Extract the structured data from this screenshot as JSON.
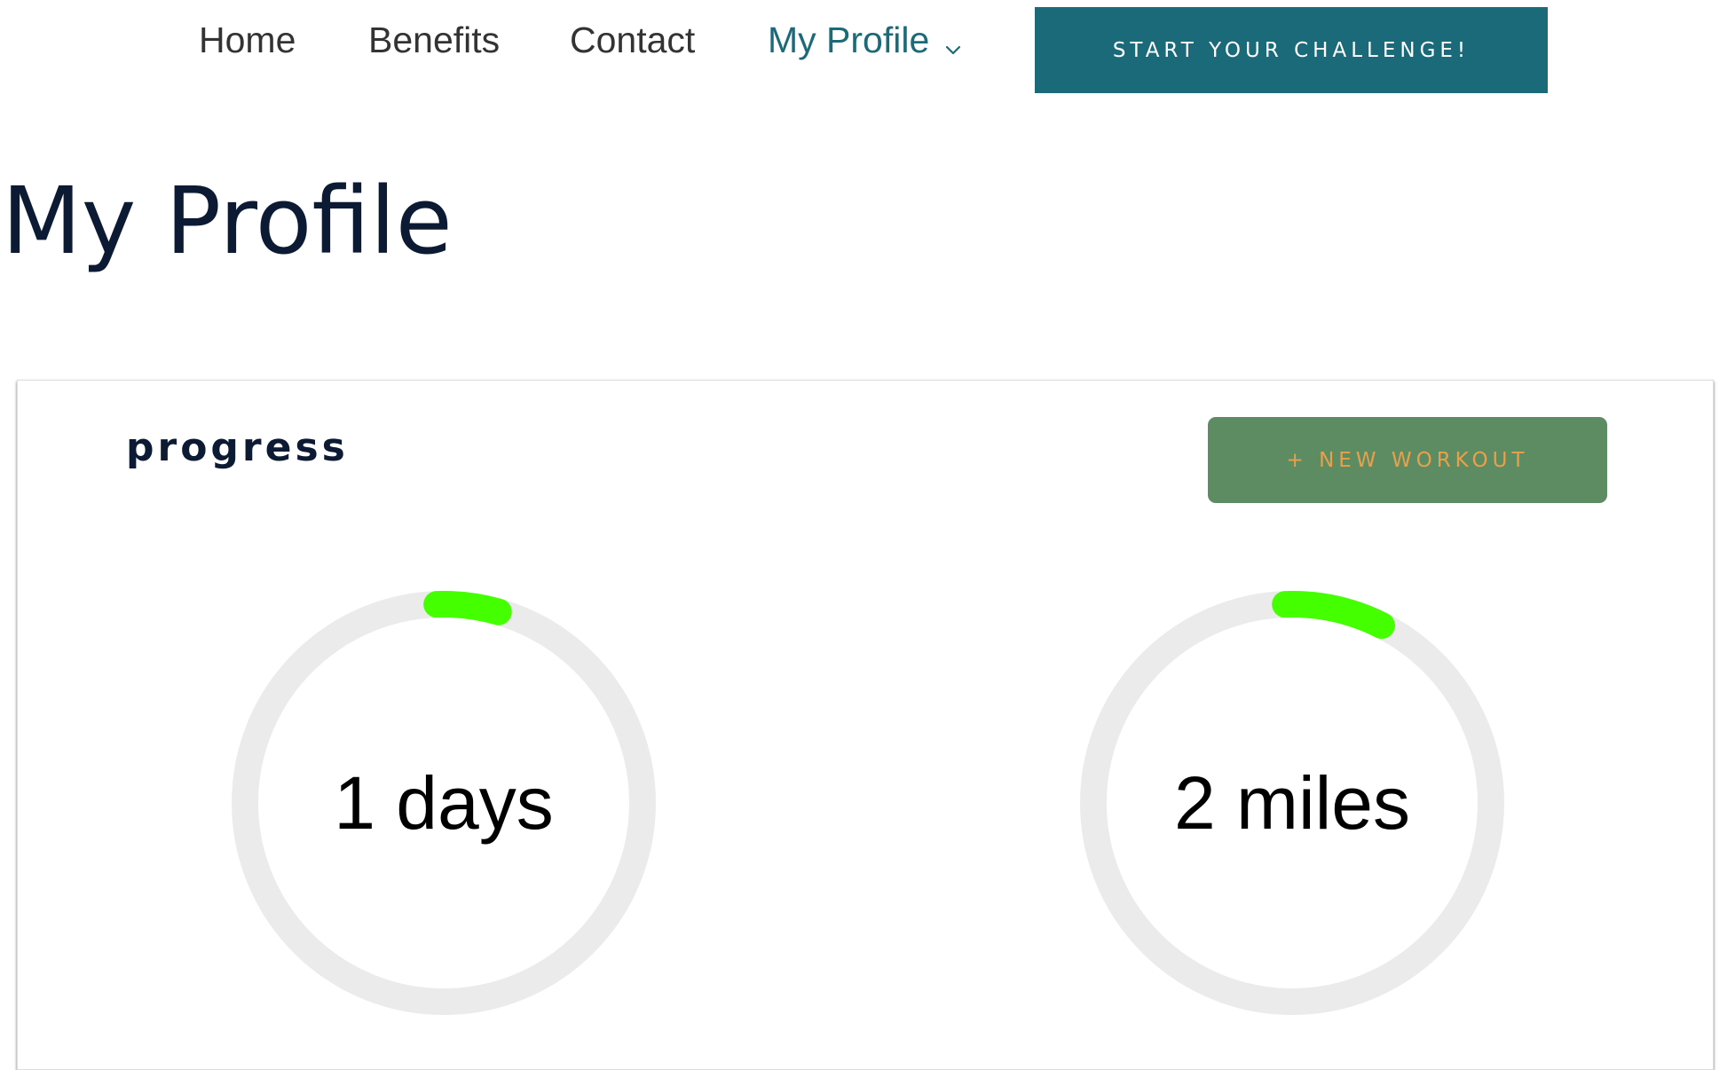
{
  "nav": {
    "items": [
      {
        "label": "Home"
      },
      {
        "label": "Benefits"
      },
      {
        "label": "Contact"
      },
      {
        "label": "My Profile",
        "active": true,
        "has_dropdown": true
      }
    ],
    "cta_label": "START YOUR CHALLENGE!"
  },
  "page": {
    "title": "My Profile"
  },
  "progress": {
    "title": "progress",
    "new_workout_label": "+ NEW WORKOUT",
    "rings": [
      {
        "label": "1 days",
        "progress_fraction": 0.05
      },
      {
        "label": "2 miles",
        "progress_fraction": 0.08
      }
    ]
  },
  "colors": {
    "primary": "#1b6a7a",
    "title_text": "#0c1a33",
    "button_green": "#5e8c62",
    "button_text_orange": "#e8a04a",
    "ring_track": "#ebebeb",
    "ring_progress": "#44ff00"
  },
  "icons": {
    "dropdown": "chevron-down-icon"
  }
}
